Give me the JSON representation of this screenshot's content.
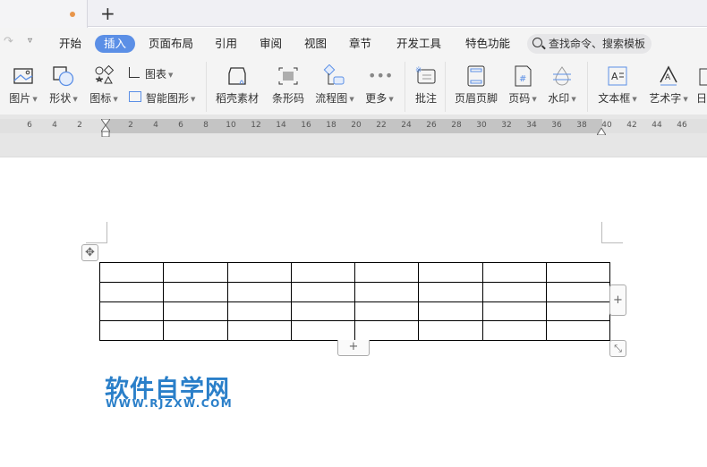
{
  "tabs": {
    "new_tab": "+"
  },
  "menu": {
    "items": [
      "开始",
      "插入",
      "页面布局",
      "引用",
      "审阅",
      "视图",
      "章节",
      "开发工具",
      "特色功能"
    ],
    "active": "插入",
    "search_placeholder": "查找命令、搜索模板"
  },
  "ribbon": {
    "picture": "图片",
    "shape": "形状",
    "icon": "图标",
    "chart": "图表",
    "smart_art": "智能图形",
    "docer_material": "稻壳素材",
    "barcode": "条形码",
    "flowchart": "流程图",
    "more": "更多",
    "comment": "批注",
    "header_footer": "页眉页脚",
    "page_number": "页码",
    "watermark": "水印",
    "text_box": "文本框",
    "word_art": "艺术字",
    "date": "日"
  },
  "ruler": {
    "ticks": [
      "6",
      "4",
      "2",
      "2",
      "4",
      "6",
      "8",
      "10",
      "12",
      "14",
      "16",
      "18",
      "20",
      "22",
      "24",
      "26",
      "28",
      "30",
      "32",
      "34",
      "36",
      "38",
      "40",
      "42",
      "44",
      "46"
    ]
  },
  "table": {
    "rows": 4,
    "cols": 8
  },
  "controls": {
    "add_row": "+",
    "add_col": "+"
  },
  "watermark": {
    "title": "软件自学网",
    "url": "WWW.RJZXW.COM"
  },
  "colors": {
    "accent": "#5b8fe6",
    "logo": "#2a7fc9"
  }
}
